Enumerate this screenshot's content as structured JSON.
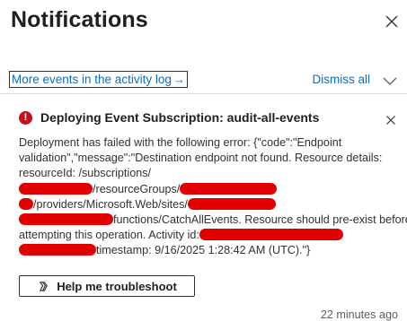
{
  "panel": {
    "title": "Notifications",
    "close_icon": "close-icon"
  },
  "toolbar": {
    "activity_log_link": "More events in the activity log",
    "arrow_glyph": "→",
    "dismiss_all": "Dismiss all",
    "expand_icon": "chevron-down-icon"
  },
  "notification": {
    "status": "error",
    "status_color": "#c50f1f",
    "title": "Deploying Event Subscription: audit-all-events",
    "message_lines": {
      "l1": "Deployment has failed with the following error: {\"code\":\"Endpoint",
      "l2": "validation\",\"message\":\"Destination endpoint not found. Resource details:",
      "l3": "resourceId: /subscriptions/",
      "l4": "/resourceGroups/",
      "l5": "/providers/Microsoft.Web/sites/",
      "l6": "functions/CatchAllEvents. Resource should pre-exist before",
      "l7": "attempting this operation. Activity id:",
      "l8": "timestamp: 9/16/2025 1:28:42 AM (UTC).\"}"
    },
    "help_button": "Help me troubleshoot",
    "time_ago": "22 minutes ago"
  },
  "colors": {
    "link": "#0f6cbd",
    "redaction": "#e00000"
  }
}
